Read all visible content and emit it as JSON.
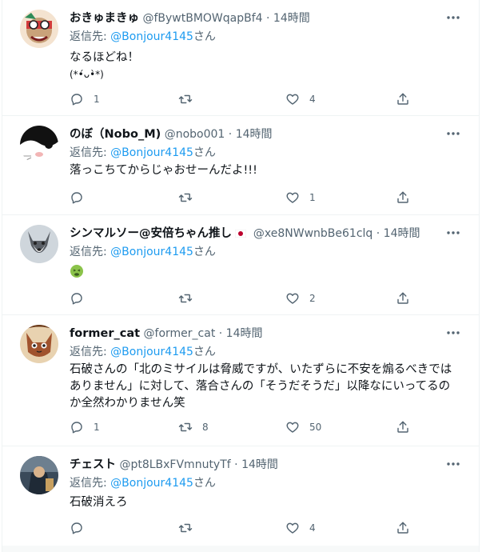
{
  "reply_prefix": "返信先: ",
  "reply_suffix": "さん",
  "dot": "·",
  "tweets": [
    {
      "name": "おきゅまきゅ",
      "handle": "@fBywtBMOWqapBf4",
      "time": "14時間",
      "reply_to": "@Bonjour4145",
      "text_lines": [
        "なるほどね！",
        "(*•́ᴗ•̀*)"
      ],
      "replies": "1",
      "retweets": "",
      "likes": "4"
    },
    {
      "name": "のぼ（Nobo_M)",
      "handle": "@nobo001",
      "time": "14時間",
      "reply_to": "@Bonjour4145",
      "text_lines": [
        "落っこちてからじゃおせーんだよ!!!"
      ],
      "replies": "",
      "retweets": "",
      "likes": "1"
    },
    {
      "name": "シンマルソー@安倍ちゃん推し",
      "handle": "@xe8NWwnbBe61clq",
      "time": "14時間",
      "reply_to": "@Bonjour4145",
      "text_lines": [
        ""
      ],
      "emoji": "nauseated-face",
      "flag": "japan-flag",
      "replies": "",
      "retweets": "",
      "likes": "2"
    },
    {
      "name": "former_cat",
      "handle": "@former_cat",
      "time": "14時間",
      "reply_to": "@Bonjour4145",
      "text_lines": [
        "石破さんの「北のミサイルは脅威ですが、いたずらに不安を煽るべきでは",
        "ありません」に対して、落合さんの「そうだそうだ」以降なにいってるの",
        "か全然わかりません笑"
      ],
      "replies": "1",
      "retweets": "8",
      "likes": "50"
    },
    {
      "name": "チェスト",
      "handle": "@pt8LBxFVmnutyTf",
      "time": "14時間",
      "reply_to": "@Bonjour4145",
      "text_lines": [
        "石破消えろ"
      ],
      "replies": "",
      "retweets": "",
      "likes": "4"
    }
  ],
  "colors": {
    "text": "#0f1419",
    "secondary": "#536471",
    "link": "#1d9bf0",
    "border": "#eff3f4"
  }
}
